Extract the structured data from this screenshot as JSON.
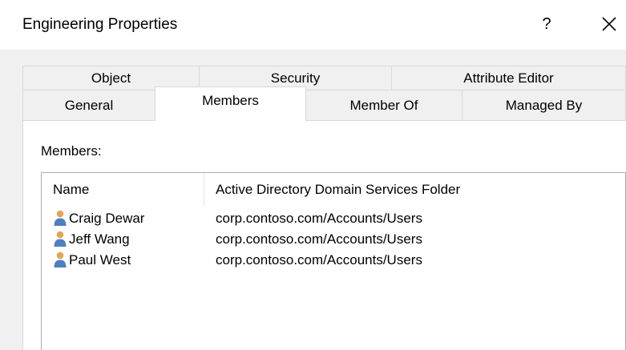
{
  "window": {
    "title": "Engineering Properties",
    "help_label": "?"
  },
  "tabs": {
    "row_back": [
      {
        "label": "Object"
      },
      {
        "label": "Security"
      },
      {
        "label": "Attribute Editor"
      }
    ],
    "row_front": [
      {
        "label": "General"
      },
      {
        "label": "Members",
        "selected": true
      },
      {
        "label": "Member Of"
      },
      {
        "label": "Managed By"
      }
    ]
  },
  "members_page": {
    "label": "Members:",
    "columns": [
      "Name",
      "Active Directory Domain Services Folder"
    ],
    "rows": [
      {
        "icon": "user-icon",
        "name": "Craig Dewar",
        "folder": "corp.contoso.com/Accounts/Users"
      },
      {
        "icon": "user-icon",
        "name": "Jeff Wang",
        "folder": "corp.contoso.com/Accounts/Users"
      },
      {
        "icon": "user-icon",
        "name": "Paul West",
        "folder": "corp.contoso.com/Accounts/Users"
      }
    ]
  },
  "colors": {
    "client_background": "#f0f0f0",
    "page_background": "#ffffff",
    "border": "#d9d9d9",
    "list_border": "#adadad",
    "user_icon_head": "#e0a55a",
    "user_icon_body": "#4f7fbf"
  }
}
